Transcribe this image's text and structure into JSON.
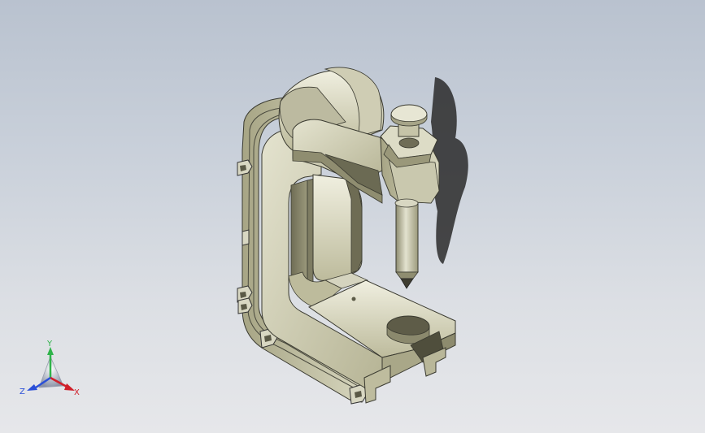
{
  "view": {
    "background_top": "#b9c2cf",
    "background_bottom": "#e6e7ea",
    "model_color": "#c8c6a8"
  },
  "triad": {
    "x_label": "X",
    "y_label": "Y",
    "z_label": "Z",
    "x_color": "#d0202a",
    "y_color": "#2fb34a",
    "z_color": "#2a4fd8"
  }
}
